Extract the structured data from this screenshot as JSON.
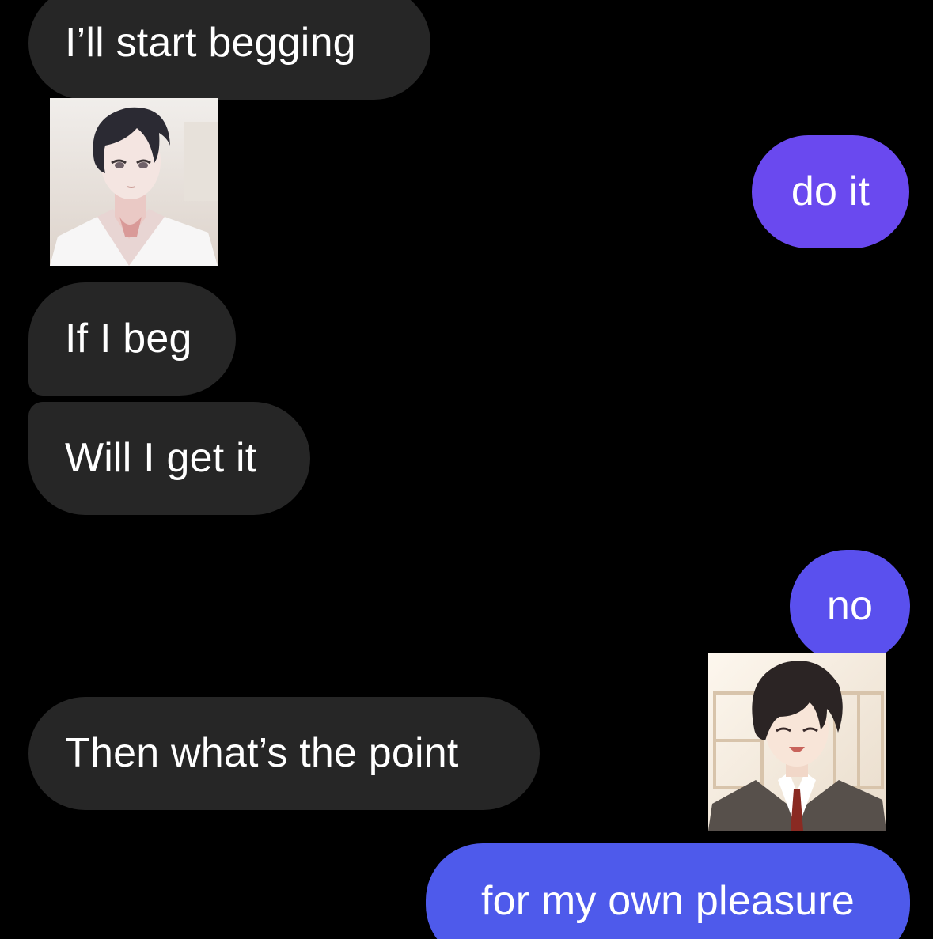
{
  "messages": {
    "m1": "I’ll start begging",
    "m2": "do it",
    "m3": "If I beg",
    "m4": "Will I get it",
    "m5": "no",
    "m6": "Then what’s the point",
    "m7": "for my own pleasure"
  },
  "colors": {
    "background": "#000000",
    "received_bubble": "#262626",
    "sent_bubble_1": "#6a49ef",
    "sent_bubble_2": "#5a50ee",
    "sent_bubble_3": "#4e5aeb",
    "text": "#ffffff"
  },
  "images": {
    "avatar1": "avatar-dark-haired-man-white-shirt",
    "avatar2": "avatar-smiling-man-suit-red-tie"
  }
}
